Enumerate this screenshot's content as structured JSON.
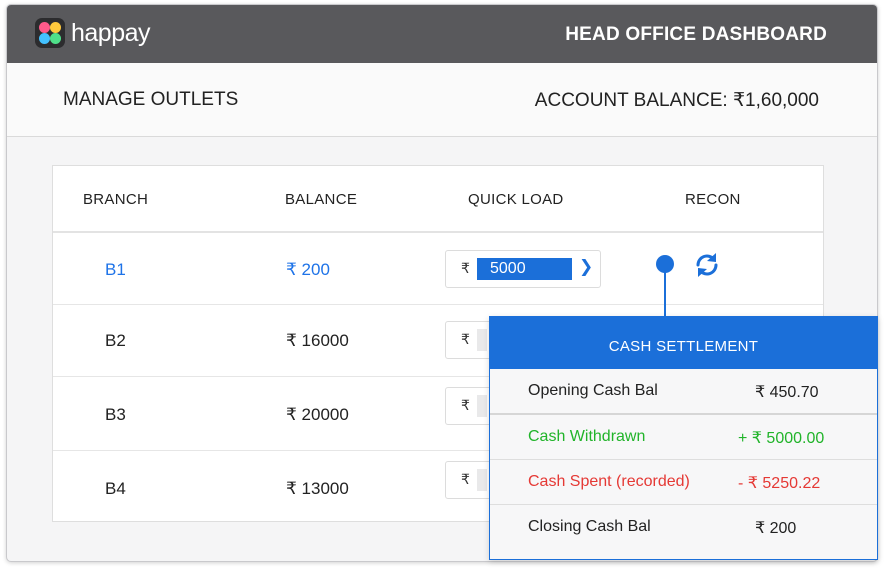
{
  "header": {
    "logo_text": "happay",
    "title": "HEAD OFFICE DASHBOARD"
  },
  "subheader": {
    "section_title": "MANAGE OUTLETS",
    "balance_label": "ACCOUNT BALANCE:",
    "balance_value": "₹1,60,000"
  },
  "table": {
    "columns": [
      "BRANCH",
      "BALANCE",
      "QUICK LOAD",
      "RECON"
    ],
    "currency_symbol": "₹",
    "rows": [
      {
        "branch": "B1",
        "balance": "₹ 200",
        "quick_load": "5000"
      },
      {
        "branch": "B2",
        "balance": "₹ 16000",
        "quick_load": ""
      },
      {
        "branch": "B3",
        "balance": "₹ 20000",
        "quick_load": ""
      },
      {
        "branch": "B4",
        "balance": "₹ 13000",
        "quick_load": ""
      }
    ]
  },
  "settlement": {
    "title": "CASH SETTLEMENT",
    "rows": [
      {
        "label": "Opening Cash Bal",
        "value": "₹ 450.70"
      },
      {
        "label": "Cash Withdrawn",
        "value": "+ ₹ 5000.00"
      },
      {
        "label": "Cash Spent (recorded)",
        "value": "- ₹ 5250.22"
      },
      {
        "label": "Closing Cash Bal",
        "value": "₹ 200"
      }
    ]
  },
  "icons": {
    "quick_load_submit": "chevron-right-icon",
    "recon": "refresh-icon"
  },
  "colors": {
    "accent": "#1b6fd9",
    "header_bg": "#59595c",
    "positive": "#21b42a",
    "negative": "#e53935"
  }
}
